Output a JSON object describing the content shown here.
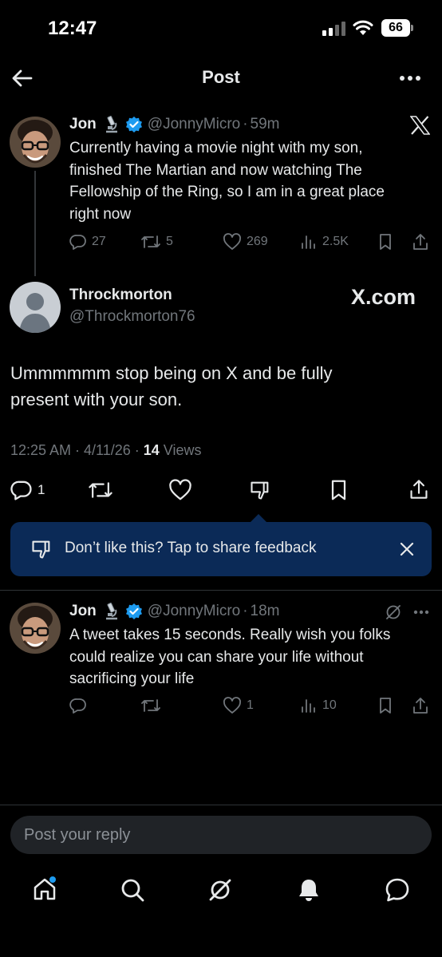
{
  "status_bar": {
    "time": "12:47",
    "battery": "66"
  },
  "header": {
    "title": "Post",
    "back_icon": "arrow-left-icon",
    "more_icon": "more-horizontal-icon"
  },
  "original_post": {
    "name": "Jon",
    "badge_icon": "microscope-icon",
    "verified_icon": "verified-badge-icon",
    "handle": "@JonnyMicro",
    "separator": "·",
    "time": "59m",
    "text_lines": [
      "Currently having a movie night with my son,",
      "finished The Martian and now watching The",
      "Fellowship of the Ring, so I am in a great place",
      "right now"
    ],
    "metrics": {
      "replies": "27",
      "reposts": "5",
      "likes": "269",
      "views": "2.5K"
    }
  },
  "reply_post": {
    "name": "Throckmorton",
    "handle": "@Throckmorton76",
    "watermark": "X.com",
    "text_lines": [
      "Ummmmmm stop being on X and be fully",
      "present with your son."
    ],
    "timestamp": "12:25 AM · 4/11/26 · ",
    "views_count": "14",
    "views_label": " Views",
    "actions": {
      "replies": "1"
    }
  },
  "feedback_banner": {
    "text": "Don’t like this? Tap to share feedback"
  },
  "second_reply": {
    "name": "Jon",
    "handle": "@JonnyMicro",
    "separator": "·",
    "time": "18m",
    "text_lines": [
      "A tweet takes 15 seconds. Really wish you folks",
      "could realize you can share your life without",
      "sacrificing your life"
    ],
    "metrics": {
      "likes": "1",
      "views": "10"
    }
  },
  "composer": {
    "placeholder": "Post your reply"
  },
  "bottom_nav": {
    "items": [
      "home-icon",
      "search-icon",
      "grok-icon",
      "notifications-icon",
      "messages-icon"
    ],
    "accent": "#1d9bf0"
  },
  "colors": {
    "background": "#000000",
    "text": "#e7e9ea",
    "muted": "#71767b",
    "accent": "#1d9bf0",
    "banner": "#0b2a57"
  }
}
